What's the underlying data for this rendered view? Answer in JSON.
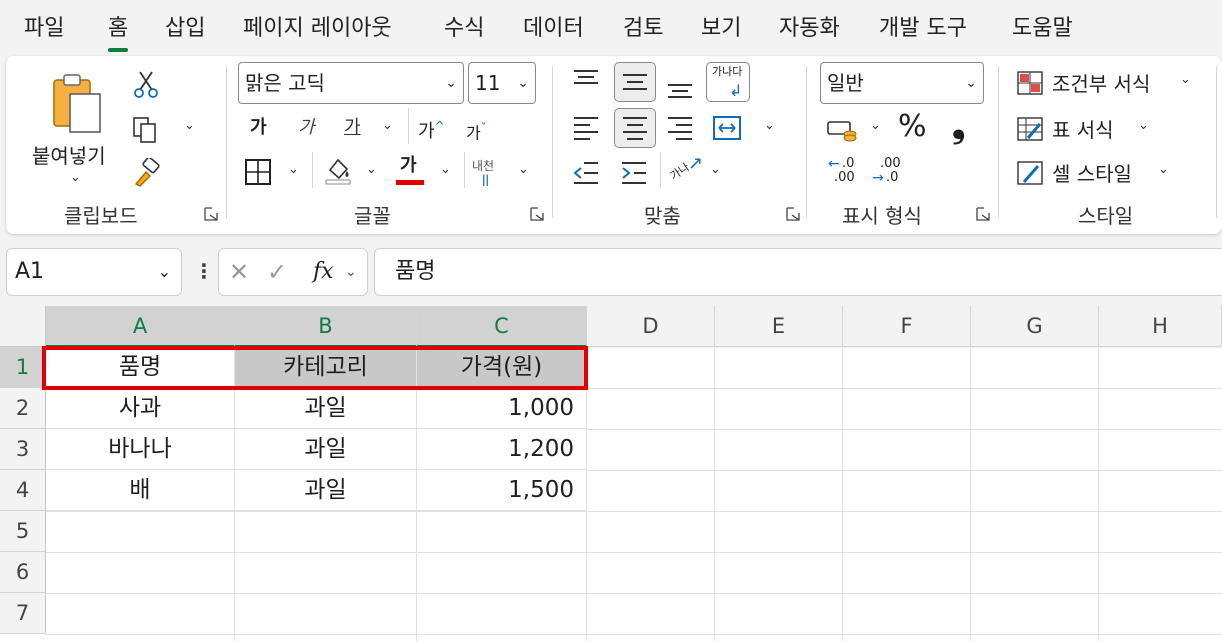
{
  "menu": {
    "tabs": [
      {
        "label": "파일"
      },
      {
        "label": "홈",
        "active": true
      },
      {
        "label": "삽입"
      },
      {
        "label": "페이지 레이아웃"
      },
      {
        "label": "수식"
      },
      {
        "label": "데이터"
      },
      {
        "label": "검토"
      },
      {
        "label": "보기"
      },
      {
        "label": "자동화"
      },
      {
        "label": "개발 도구"
      },
      {
        "label": "도움말"
      }
    ]
  },
  "ribbon": {
    "clipboard": {
      "paste_label": "붙여넣기",
      "group_label": "클립보드"
    },
    "font": {
      "font_name": "맑은 고딕",
      "font_size": "11",
      "bold_glyph": "가",
      "italic_glyph": "가",
      "underline_glyph": "가",
      "grow_glyph": "가",
      "shrink_glyph": "가",
      "font_color_glyph": "가",
      "phonetic_glyph": "내천",
      "group_label": "글꼴"
    },
    "alignment": {
      "wrap_glyph": "가나다",
      "orientation_glyph": "가나",
      "group_label": "맞춤"
    },
    "number": {
      "format": "일반",
      "percent": "%",
      "comma": "❟",
      "inc_decimal": ".0",
      "dec_decimal": ".00",
      "group_label": "표시 형식"
    },
    "styles": {
      "conditional": "조건부 서식",
      "table": "표 서식",
      "cell": "셀 스타일",
      "group_label": "스타일"
    }
  },
  "formula_bar": {
    "name_box": "A1",
    "fx": "fx",
    "content": "품명"
  },
  "sheet": {
    "columns": [
      "A",
      "B",
      "C",
      "D",
      "E",
      "F",
      "G",
      "H"
    ],
    "rows": [
      "1",
      "2",
      "3",
      "4",
      "5",
      "6",
      "7"
    ],
    "cells": [
      [
        "품명",
        "카테고리",
        "가격(원)"
      ],
      [
        "사과",
        "과일",
        "1,000"
      ],
      [
        "바나나",
        "과일",
        "1,200"
      ],
      [
        "배",
        "과일",
        "1,500"
      ]
    ]
  },
  "colors": {
    "accent": "#107c41",
    "highlight": "#e00000",
    "font_color": "#e00000"
  }
}
